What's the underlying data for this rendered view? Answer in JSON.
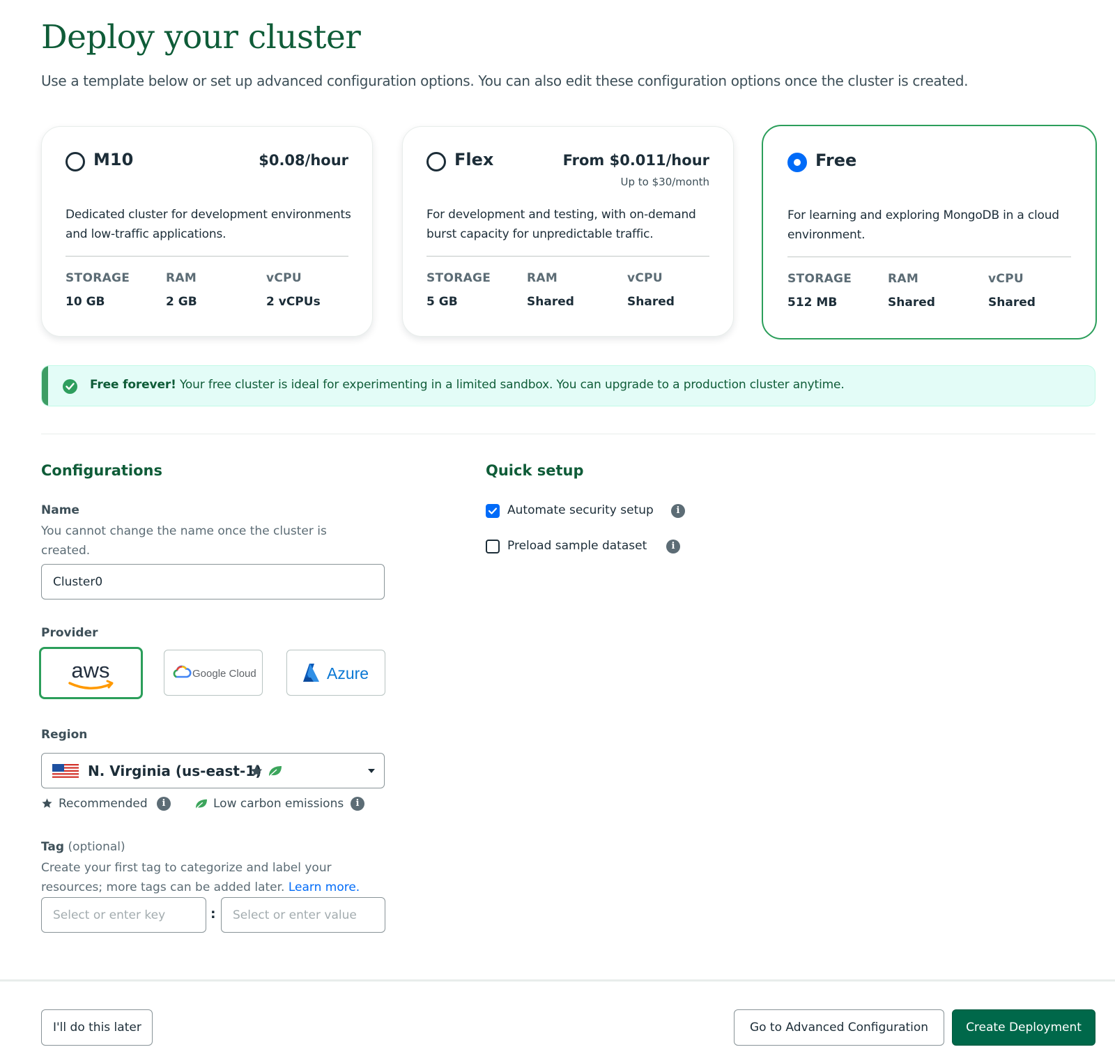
{
  "header": {
    "title": "Deploy your cluster",
    "subtitle": "Use a template below or set up advanced configuration options. You can also edit these configuration options once the cluster is created."
  },
  "tiers": [
    {
      "name": "M10",
      "price": "$0.08/hour",
      "price_sub": "",
      "description": "Dedicated cluster for development environments and low-traffic applications.",
      "selected": false,
      "specs": [
        {
          "label": "STORAGE",
          "value": "10 GB"
        },
        {
          "label": "RAM",
          "value": "2 GB"
        },
        {
          "label": "vCPU",
          "value": "2 vCPUs"
        }
      ]
    },
    {
      "name": "Flex",
      "price": "From $0.011/hour",
      "price_sub": "Up to $30/month",
      "description": "For development and testing, with on-demand burst capacity for unpredictable traffic.",
      "selected": false,
      "specs": [
        {
          "label": "STORAGE",
          "value": "5 GB"
        },
        {
          "label": "RAM",
          "value": "Shared"
        },
        {
          "label": "vCPU",
          "value": "Shared"
        }
      ]
    },
    {
      "name": "Free",
      "price": "",
      "price_sub": "",
      "description": "For learning and exploring MongoDB in a cloud environment.",
      "selected": true,
      "specs": [
        {
          "label": "STORAGE",
          "value": "512 MB"
        },
        {
          "label": "RAM",
          "value": "Shared"
        },
        {
          "label": "vCPU",
          "value": "Shared"
        }
      ]
    }
  ],
  "banner": {
    "bold": "Free forever!",
    "text": " Your free cluster is ideal for experimenting in a limited sandbox. You can upgrade to a production cluster anytime."
  },
  "configurations": {
    "title": "Configurations",
    "name_label": "Name",
    "name_help": "You cannot change the name once the cluster is created.",
    "name_value": "Cluster0",
    "provider_label": "Provider",
    "providers": [
      {
        "name": "aws",
        "selected": true
      },
      {
        "name": "Google Cloud",
        "selected": false
      },
      {
        "name": "Azure",
        "selected": false
      }
    ],
    "region_label": "Region",
    "region_value": "N. Virginia (us-east-1)",
    "legend_recommended": "Recommended",
    "legend_low_carbon": "Low carbon emissions",
    "tag_label": "Tag",
    "tag_optional": " (optional)",
    "tag_help": "Create your first tag to categorize and label your resources; more tags can be added later. ",
    "tag_learn_more": "Learn more.",
    "tag_key_placeholder": "Select or enter key",
    "tag_separator": ":",
    "tag_value_placeholder": "Select or enter value"
  },
  "quick_setup": {
    "title": "Quick setup",
    "options": [
      {
        "label": "Automate security setup",
        "checked": true
      },
      {
        "label": "Preload sample dataset",
        "checked": false
      }
    ]
  },
  "footer": {
    "later": "I'll do this later",
    "advanced": "Go to Advanced Configuration",
    "create": "Create Deployment"
  },
  "colors": {
    "brand_green": "#00684a",
    "selected_border": "#2b9e5a",
    "radio_selected": "#016bf8",
    "banner_bg": "#e3fcf7"
  }
}
